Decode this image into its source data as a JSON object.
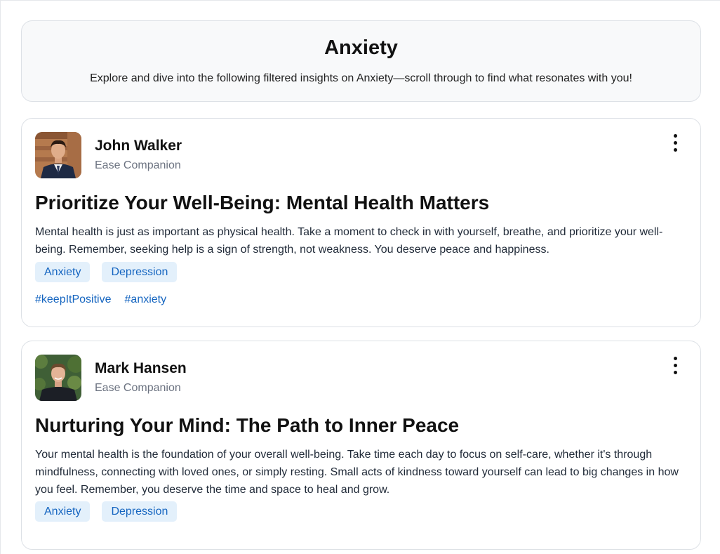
{
  "header": {
    "title": "Anxiety",
    "subtitle": "Explore and dive into the following filtered insights on Anxiety—scroll through to find what resonates with you!"
  },
  "posts": [
    {
      "author": "John Walker",
      "role": "Ease Companion",
      "avatar_icon": "person-photo-icon",
      "menu_icon": "more-vertical-icon",
      "title": "Prioritize Your Well-Being: Mental Health Matters",
      "body": "Mental health is just as important as physical health. Take a moment to check in with yourself, breathe, and prioritize your well-being. Remember, seeking help is a sign of strength, not weakness. You deserve peace and happiness.",
      "tags": [
        "Anxiety",
        "Depression"
      ],
      "hashtags": [
        "#keepItPositive",
        "#anxiety"
      ]
    },
    {
      "author": "Mark Hansen",
      "role": "Ease Companion",
      "avatar_icon": "person-photo-icon",
      "menu_icon": "more-vertical-icon",
      "title": "Nurturing Your Mind: The Path to Inner Peace",
      "body": "Your mental health is the foundation of your overall well-being. Take time each day to focus on self-care, whether it's through mindfulness, connecting with loved ones, or simply resting. Small acts of kindness toward yourself can lead to big changes in how you feel. Remember, you deserve the time and space to heal and grow.",
      "tags": [
        "Anxiety",
        "Depression"
      ],
      "hashtags": []
    }
  ],
  "colors": {
    "accent": "#1565c0",
    "tag_bg": "#e3f0fb",
    "header_bg": "#f8f9fa",
    "border": "#dde1e6"
  }
}
